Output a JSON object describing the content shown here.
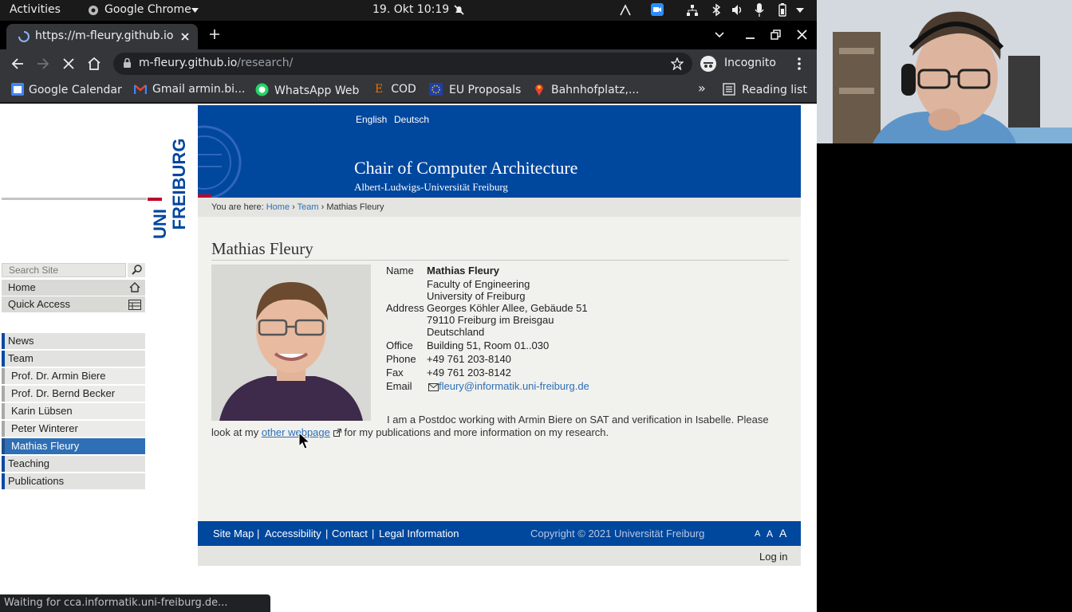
{
  "topbar": {
    "activities": "Activities",
    "app": "Google Chrome",
    "clock": "19. Okt  10:19"
  },
  "browser": {
    "tab_title": "https://m-fleury.github.io",
    "url_host": "m-fleury.github.io",
    "url_path": "/research/",
    "incognito_label": "Incognito",
    "status_text": "Waiting for cca.informatik.uni-freiburg.de...",
    "bookmarks": [
      {
        "label": "Google Calendar",
        "icon": "calendar-icon"
      },
      {
        "label": "Gmail armin.bi...",
        "icon": "gmail-icon"
      },
      {
        "label": "WhatsApp Web",
        "icon": "whatsapp-icon"
      },
      {
        "label": "COD",
        "icon": "cod-icon"
      },
      {
        "label": "EU Proposals",
        "icon": "eu-icon"
      },
      {
        "label": "Bahnhofplatz,...",
        "icon": "maps-pin-icon"
      }
    ],
    "reading_list": "Reading list"
  },
  "site": {
    "logo_text": "UNI FREIBURG",
    "lang": {
      "en": "English",
      "de": "Deutsch"
    },
    "title": "Chair of Computer Architecture",
    "subtitle": "Albert-Ludwigs-Universität Freiburg",
    "breadcrumb": {
      "prefix": "You are here:",
      "home": "Home",
      "team": "Team",
      "current": "Mathias Fleury",
      "sep": "›"
    },
    "search_placeholder": "Search Site",
    "quick_nav": {
      "home": "Home",
      "quick_access": "Quick Access"
    },
    "nav": {
      "news": "News",
      "team": "Team",
      "team_members": [
        "Prof. Dr. Armin Biere",
        "Prof. Dr. Bernd Becker",
        "Karin Lübsen",
        "Peter Winterer",
        "Mathias Fleury"
      ],
      "teaching": "Teaching",
      "publications": "Publications"
    }
  },
  "person": {
    "heading": "Mathias Fleury",
    "labels": {
      "name": "Name",
      "address": "Address",
      "office": "Office",
      "phone": "Phone",
      "fax": "Fax",
      "email": "Email"
    },
    "name": "Mathias Fleury",
    "address": [
      "Faculty of Engineering",
      "University of Freiburg",
      "Georges Köhler Allee, Gebäude 51",
      "79110 Freiburg im Breisgau",
      "Deutschland"
    ],
    "office": "Building 51, Room 01..030",
    "phone": "+49 761 203-8140",
    "fax": "+49 761 203-8142",
    "email": "fleury@informatik.uni-freiburg.de",
    "bio_start": "I am a Postdoc working with Armin Biere on SAT and verification in Isabelle. Please look at my ",
    "bio_link": "other webpage",
    "bio_end": " for my publications and more information on my research."
  },
  "footer": {
    "links": [
      "Site Map",
      "Accessibility",
      "Contact",
      "Legal Information"
    ],
    "sep": "|",
    "copyright": "Copyright © 2021 Universität Freiburg",
    "font_sizes": [
      "A",
      "A",
      "A"
    ],
    "login": "Log in"
  }
}
